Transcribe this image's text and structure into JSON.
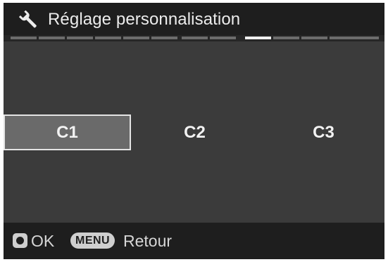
{
  "header": {
    "icon": "wrench-icon",
    "title": "Réglage personnalisation"
  },
  "tabs": {
    "count": 12,
    "active_index": 8
  },
  "options": [
    {
      "label": "C1",
      "selected": true
    },
    {
      "label": "C2",
      "selected": false
    },
    {
      "label": "C3",
      "selected": false
    }
  ],
  "footer": {
    "ok_icon": "ok-button-icon",
    "ok_label": "OK",
    "menu_key": "MENU",
    "back_label": "Retour"
  },
  "colors": {
    "background": "#3b3b3b",
    "bars": "#1e1e1e",
    "selected_fill": "#6a6a6a",
    "selected_border": "#e4e4e4"
  }
}
